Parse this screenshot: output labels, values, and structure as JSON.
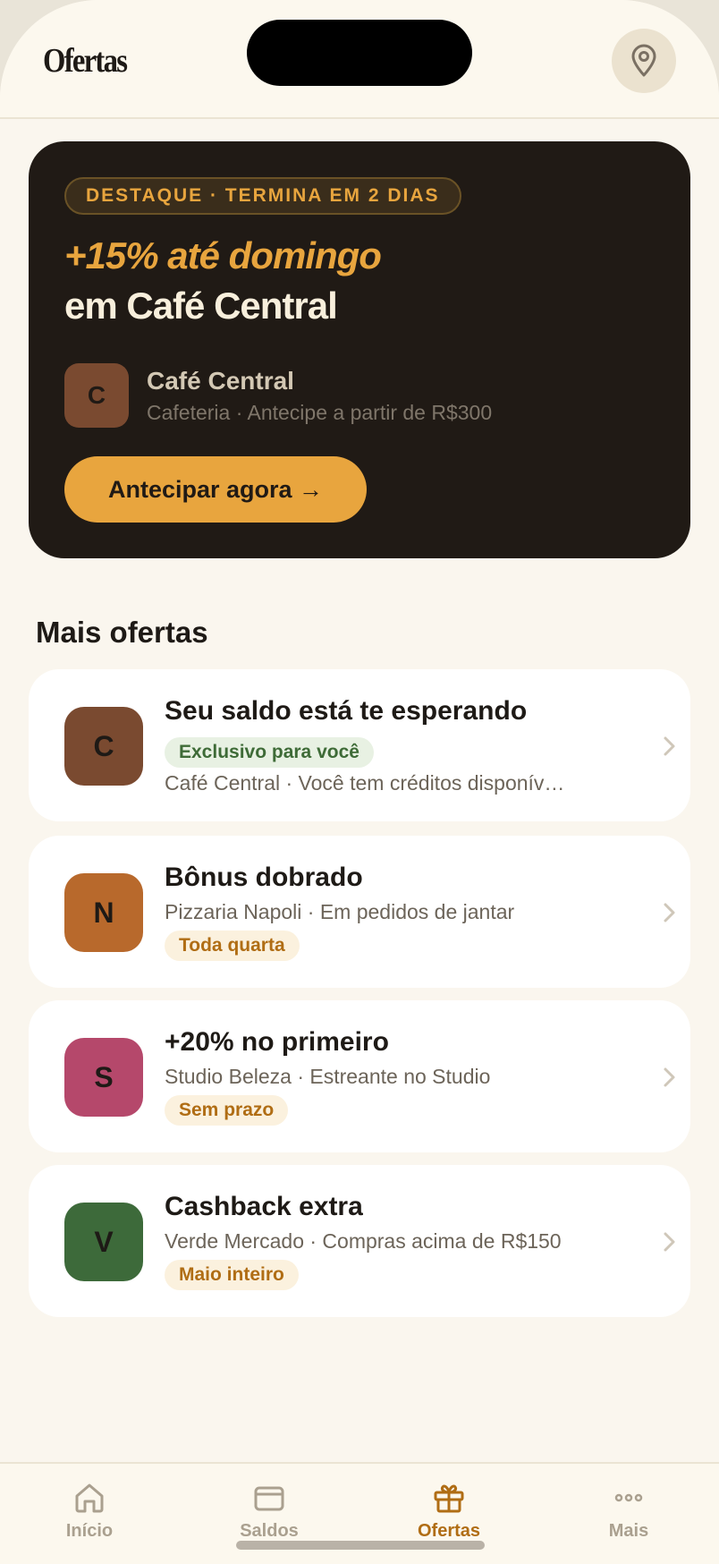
{
  "header": {
    "title": "Ofertas",
    "location_icon": "map-pin-icon"
  },
  "hero": {
    "badge": "DESTAQUE · TERMINA EM 2 DIAS",
    "title_highlight": "+15% até domingo",
    "title_rest": "em Café Central",
    "merchant_initial": "C",
    "merchant_name": "Café Central",
    "merchant_meta": "Cafeteria · Antecipe a partir de R$300",
    "cta_label": "Antecipar agora →",
    "colors": {
      "background": "#201a15",
      "accent": "#e8a53e"
    }
  },
  "section": {
    "title": "Mais ofertas"
  },
  "offers": [
    {
      "initial": "C",
      "avatar_color": "#7a4a30",
      "title": "Seu saldo está te esperando",
      "tag": "Exclusivo para você",
      "tag_style": "green",
      "meta": "Café Central · Você tem créditos disponív…"
    },
    {
      "initial": "N",
      "avatar_color": "#b8692c",
      "title": "Bônus dobrado",
      "meta": "Pizzaria Napoli · Em pedidos de jantar",
      "tag": "Toda quarta",
      "tag_style": "amber"
    },
    {
      "initial": "S",
      "avatar_color": "#b5486b",
      "title": "+20% no primeiro",
      "meta": "Studio Beleza · Estreante no Studio",
      "tag": "Sem prazo",
      "tag_style": "amber"
    },
    {
      "initial": "V",
      "avatar_color": "#3d6a3a",
      "title": "Cashback extra",
      "meta": "Verde Mercado · Compras acima de R$150",
      "tag": "Maio inteiro",
      "tag_style": "amber"
    }
  ],
  "tabbar": {
    "items": [
      {
        "label": "Início",
        "icon": "home-icon",
        "active": false
      },
      {
        "label": "Saldos",
        "icon": "wallet-icon",
        "active": false
      },
      {
        "label": "Ofertas",
        "icon": "gift-icon",
        "active": true
      },
      {
        "label": "Mais",
        "icon": "more-dots-icon",
        "active": false
      }
    ],
    "active_color": "#b06d14"
  }
}
